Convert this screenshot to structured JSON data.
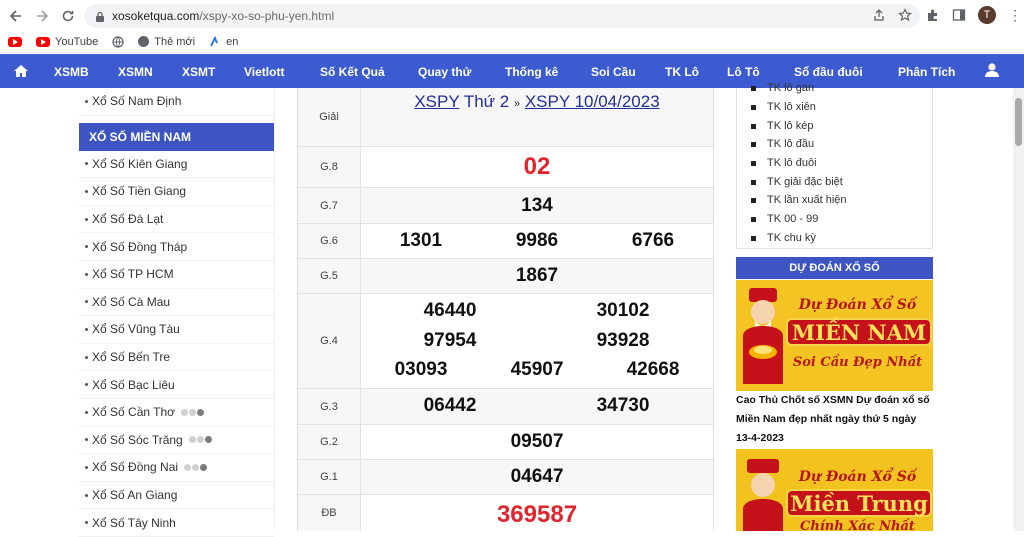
{
  "browser": {
    "url_host": "xosoketqua.com",
    "url_path": "/xspy-xo-so-phu-yen.html",
    "avatar_letter": "T",
    "bookmarks": [
      {
        "label": "YouTube"
      },
      {
        "label": "Thẻ mới"
      },
      {
        "label": "en"
      }
    ]
  },
  "navbar": {
    "items": [
      "XSMB",
      "XSMN",
      "XSMT",
      "Vietlott",
      "Số Kết Quả",
      "Quay thử",
      "Thống kê",
      "Soi Cầu",
      "TK Lô",
      "Lô Tô",
      "Sổ đầu đuôi",
      "Phân Tích"
    ]
  },
  "left": {
    "top_item": "Xổ Số Nam Định",
    "header": "XỔ SỐ MIỀN NAM",
    "items": [
      "Xổ Số Kiên Giang",
      "Xổ Số Tiền Giang",
      "Xổ Số Đà Lạt",
      "Xổ Số Đồng Tháp",
      "Xổ Số TP HCM",
      "Xổ Số Cà Mau",
      "Xổ Số Vũng Tàu",
      "Xổ Số Bến Tre",
      "Xổ Số Bạc Liêu",
      "Xổ Số Cần Thơ",
      "Xổ Số Sóc Trăng",
      "Xổ Số Đồng Nai",
      "Xổ Số An Giang",
      "Xổ Số Tây Ninh"
    ]
  },
  "results": {
    "title_label": "Giải",
    "title_link1": "XSPY",
    "title_mid": "Thứ 2",
    "title_sep": "»",
    "title_link2": "XSPY 10/04/2023",
    "prizes": [
      {
        "label": "G.8",
        "numbers": [
          "02"
        ]
      },
      {
        "label": "G.7",
        "numbers": [
          "134"
        ]
      },
      {
        "label": "G.6",
        "numbers": [
          "1301",
          "9986",
          "6766"
        ]
      },
      {
        "label": "G.5",
        "numbers": [
          "1867"
        ]
      },
      {
        "label": "G.4",
        "numbers": [
          "46440",
          "30102",
          "97954",
          "93928",
          "03093",
          "45907",
          "42668"
        ]
      },
      {
        "label": "G.3",
        "numbers": [
          "06442",
          "34730"
        ]
      },
      {
        "label": "G.2",
        "numbers": [
          "09507"
        ]
      },
      {
        "label": "G.1",
        "numbers": [
          "04647"
        ]
      },
      {
        "label": "ĐB",
        "numbers": [
          "369587"
        ]
      }
    ]
  },
  "right": {
    "stats": [
      "TK lô gan",
      "TK lô xiên",
      "TK lô kép",
      "TK lô đầu",
      "TK lô đuôi",
      "TK giải đặc biệt",
      "TK lần xuất hiện",
      "TK 00 - 99",
      "TK chu kỳ"
    ],
    "predict_header": "DỰ ĐOÁN XỔ SỐ",
    "banner1": {
      "top": "Dự Đoán Xổ Số",
      "title": "MIỀN NAM",
      "sub": "Soi Cầu Đẹp Nhất"
    },
    "caption": "Cao Thủ Chốt số XSMN Dự đoán xổ số Miền Nam đẹp nhất ngày thứ 5 ngày 13-4-2023",
    "banner2": {
      "top": "Dự Đoán Xổ Số",
      "title": "Miền Trung",
      "sub": "Chính Xác Nhất"
    }
  },
  "colors": {
    "navbar": "#3d5bd0",
    "section_header": "#3d55c3",
    "special_prize": "#e0262d",
    "link": "#22309a"
  }
}
